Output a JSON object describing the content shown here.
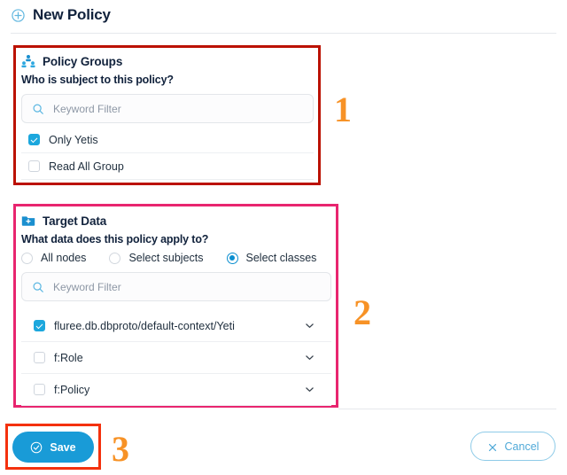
{
  "header": {
    "title": "New Policy",
    "plus_icon": "plus-circle-icon"
  },
  "policy_groups": {
    "icon": "people-group-icon",
    "title": "Policy Groups",
    "question": "Who is subject to this policy?",
    "search": {
      "icon": "search-icon",
      "placeholder": "Keyword Filter",
      "value": ""
    },
    "items": [
      {
        "label": "Only Yetis",
        "checked": true
      },
      {
        "label": "Read All Group",
        "checked": false
      }
    ]
  },
  "target_data": {
    "icon": "folder-plus-icon",
    "title": "Target Data",
    "question": "What data does this policy apply to?",
    "scope_options": [
      {
        "label": "All nodes",
        "selected": false
      },
      {
        "label": "Select subjects",
        "selected": false
      },
      {
        "label": "Select classes",
        "selected": true
      }
    ],
    "search": {
      "icon": "search-icon",
      "placeholder": "Keyword Filter",
      "value": ""
    },
    "classes": [
      {
        "label": "fluree.db.dbproto/default-context/Yeti",
        "checked": true,
        "expand_icon": "chevron-down-icon"
      },
      {
        "label": "f:Role",
        "checked": false,
        "expand_icon": "chevron-down-icon"
      },
      {
        "label": "f:Policy",
        "checked": false,
        "expand_icon": "chevron-down-icon"
      }
    ]
  },
  "footer": {
    "save_label": "Save",
    "save_icon": "check-circle-icon",
    "cancel_label": "Cancel",
    "cancel_icon": "close-x-icon"
  },
  "annotations": [
    {
      "number": "1",
      "target": "policy-groups-section",
      "color": "#f79226",
      "box_color": "#bb1100"
    },
    {
      "number": "2",
      "target": "target-data-section",
      "color": "#f79226",
      "box_color": "#e8256f"
    },
    {
      "number": "3",
      "target": "save-button",
      "color": "#f79226",
      "box_color": "#f4310d"
    }
  ],
  "colors": {
    "accent_blue": "#199bd7",
    "checkbox_checked": "#1ca7dd",
    "radio_selected": "#0b8fd0",
    "title_text": "#11223c",
    "annotation_orange": "#f79226"
  }
}
